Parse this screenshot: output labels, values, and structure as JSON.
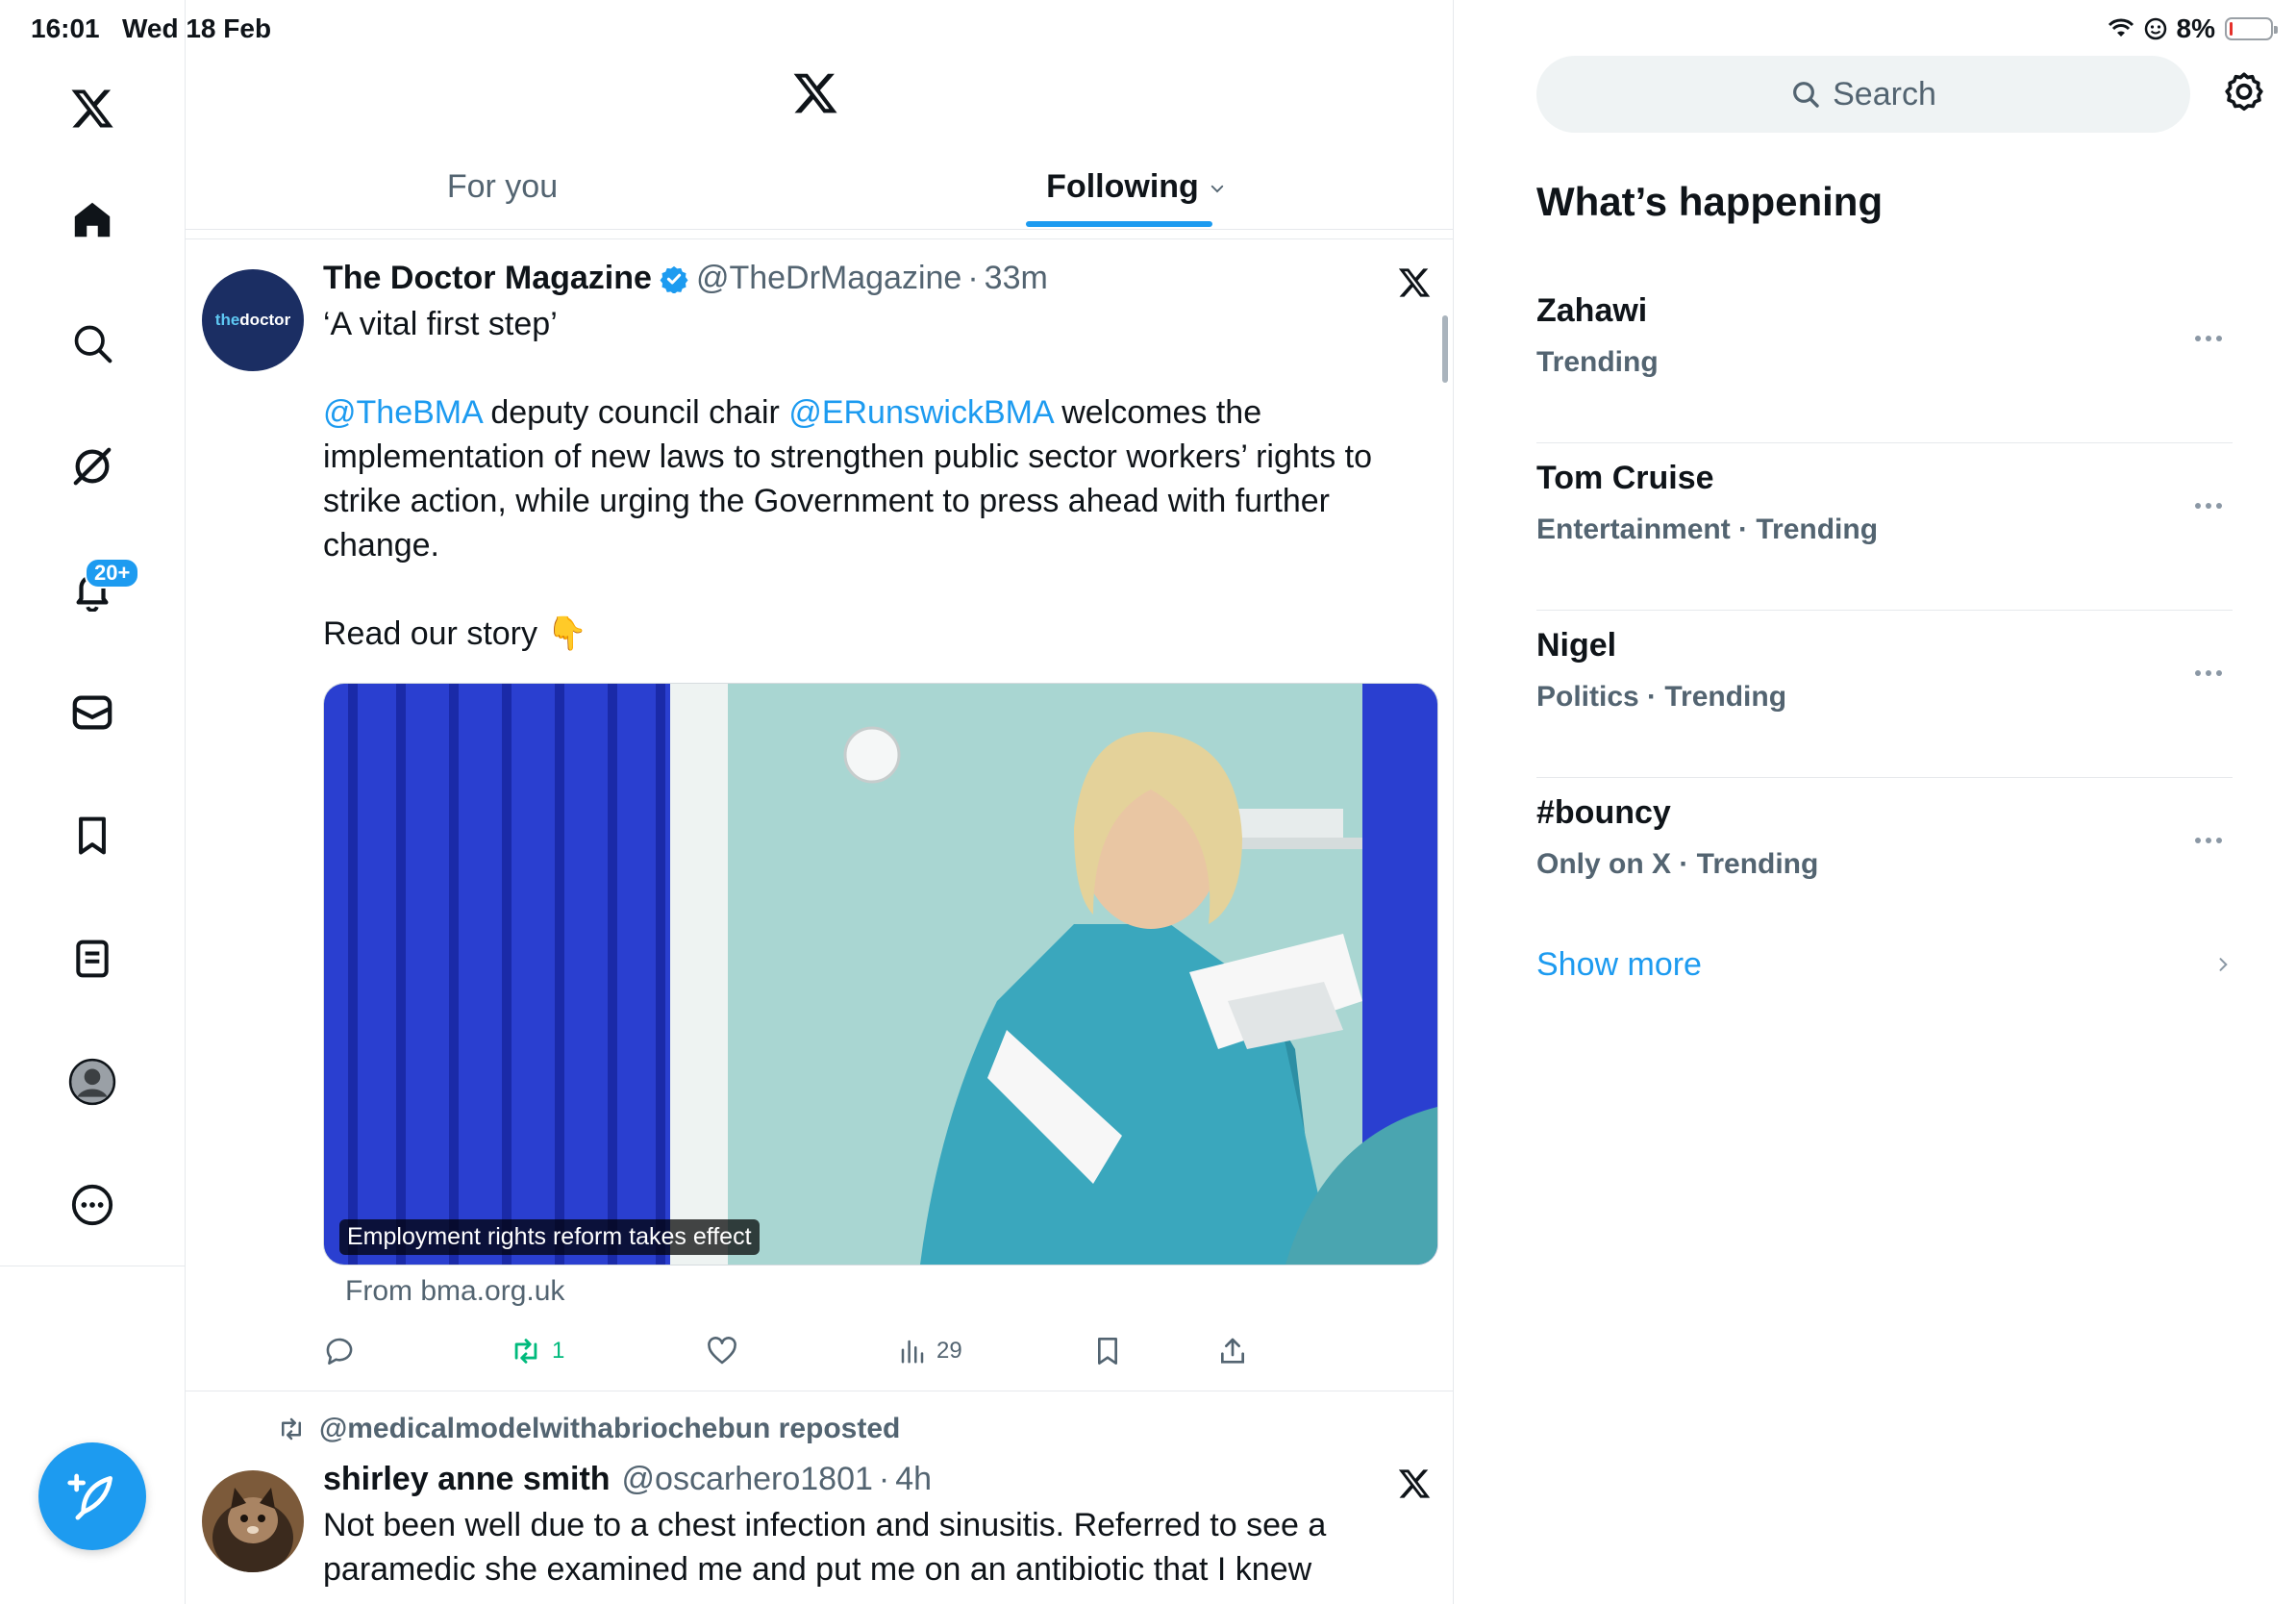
{
  "status_bar": {
    "time": "16:01",
    "date": "Wed 18 Feb",
    "battery_percent": "8%",
    "battery_level": 0.08
  },
  "nav": {
    "items": [
      "x-logo",
      "home",
      "explore",
      "grok",
      "notifications",
      "messages",
      "bookmarks",
      "lists",
      "profile",
      "more"
    ],
    "notifications_badge": "20+"
  },
  "tabs": {
    "for_you": "For you",
    "following": "Following"
  },
  "tweets": [
    {
      "author": "The Doctor Magazine",
      "handle": "@TheDrMagazine",
      "separator": "·",
      "time": "33m",
      "avatar_text_pre": "the",
      "avatar_text_main": "doctor",
      "text_line1": "‘A vital first step’",
      "mention1": "@TheBMA",
      "text_mid": " deputy council chair ",
      "mention2": "@ERunswickBMA",
      "text_rest": " welcomes the implementation of new laws to strengthen public sector workers’ rights to strike action, while urging the Government to press ahead with further change.",
      "text_cta": "Read our story 👇",
      "media_caption": "Employment rights reform takes effect",
      "link_source": "From bma.org.uk",
      "retweets": "1",
      "views": "29"
    },
    {
      "repost_by": "@medicalmodelwithabriochebun reposted",
      "author": "shirley anne smith",
      "handle": "@oscarhero1801",
      "separator": "·",
      "time": "4h",
      "text": "Not been well due to a chest infection and sinusitis. Referred to see a paramedic she examined me and put me on an antibiotic that I knew"
    }
  ],
  "sidebar": {
    "search_placeholder": "Search",
    "whats_happening": "What’s happening",
    "trends": [
      {
        "name": "Zahawi",
        "meta": "Trending"
      },
      {
        "name": "Tom Cruise",
        "meta": "Entertainment · Trending"
      },
      {
        "name": "Nigel",
        "meta": "Politics · Trending"
      },
      {
        "name": "#bouncy",
        "meta": "Only on X · Trending"
      }
    ],
    "show_more": "Show more"
  },
  "colors": {
    "accent": "#1d9bf0",
    "text": "#0f1419",
    "muted": "#536471",
    "retweet": "#00ba7c",
    "avatar_doctor": "#1b2e63"
  }
}
